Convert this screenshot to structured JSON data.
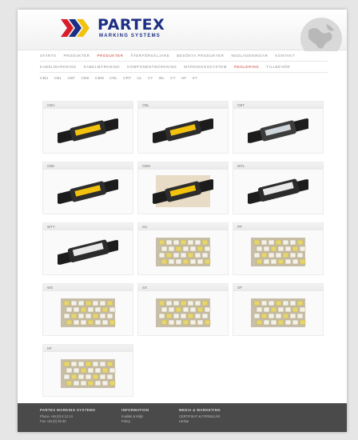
{
  "brand": {
    "name": "PARTEX",
    "tagline": "MARKING SYSTEMS"
  },
  "nav": {
    "primary": [
      {
        "label": "STARTS",
        "active": false
      },
      {
        "label": "PRODUKTER",
        "active": false
      },
      {
        "label": "PRODUKTER",
        "active": true
      },
      {
        "label": "ÅTERFÖRSÄLJARE",
        "active": false
      },
      {
        "label": "BESÖKTA PRODUKTER",
        "active": false
      },
      {
        "label": "NEDLADDNINGAR",
        "active": false
      },
      {
        "label": "KONTAKT",
        "active": false
      }
    ],
    "secondary": [
      {
        "label": "KABELMARKNING",
        "active": false
      },
      {
        "label": "KABELMÄRKNING",
        "active": false
      },
      {
        "label": "KOMPONENTMÄRKNING",
        "active": false
      },
      {
        "label": "MÄRKNINGSSYSTEM",
        "active": false
      },
      {
        "label": "REGLERING",
        "active": true
      },
      {
        "label": "TILLBEHÖR",
        "active": false
      }
    ],
    "tertiary": [
      "CBU",
      "CBL",
      "CBT",
      "CBE",
      "CBM",
      "CRL",
      "CRT",
      "UL",
      "VY",
      "WL",
      "CT",
      "HF",
      "ST"
    ]
  },
  "products": [
    {
      "code": "CBU",
      "image": "cable-yellow-marker"
    },
    {
      "code": "CBL",
      "image": "cable-yellow-marker"
    },
    {
      "code": "CBT",
      "image": "cable-clear-marker"
    },
    {
      "code": "CBE",
      "image": "cable-yellow-marker"
    },
    {
      "code": "CBM",
      "image": "cable-yellow-marker-beige"
    },
    {
      "code": "WTL",
      "image": "cable-white-label"
    },
    {
      "code": "WTY",
      "image": "cable-white-label"
    },
    {
      "code": "SU",
      "image": "marker-strips"
    },
    {
      "code": "PP",
      "image": "marker-strips"
    },
    {
      "code": "WS",
      "image": "marker-strips"
    },
    {
      "code": "SX",
      "image": "marker-strips"
    },
    {
      "code": "SP",
      "image": "marker-strips"
    },
    {
      "code": "HF",
      "image": "marker-strips"
    }
  ],
  "footer": {
    "cols": [
      {
        "heading": "PARTEX MARKING SYSTEMS",
        "lines": [
          "Phone +46 (0) 8 12 24",
          "Fax +46 (0) 36 00"
        ]
      },
      {
        "heading": "INFORMATION",
        "lines": [
          "Kvalitet & Miljö",
          "Policy"
        ]
      },
      {
        "heading": "MEDIA & MARKETING",
        "lines": [
          "CERTIFIKAT & FORMULÄR",
          "Länkar"
        ]
      }
    ]
  },
  "colors": {
    "brand_blue": "#1d2f84",
    "brand_red": "#d81e2a",
    "active_nav": "#c0392b",
    "footer_bg": "#4a4a4a"
  }
}
